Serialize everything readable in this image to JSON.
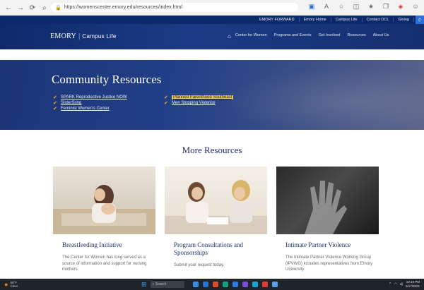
{
  "browser": {
    "url": "https://womenscenter.emory.edu/resources/index.html",
    "nav_icons": [
      "back-icon",
      "forward-icon",
      "refresh-icon"
    ],
    "tool_icons": [
      "extension-icon",
      "read-aloud-icon",
      "favorite-icon",
      "split-screen-icon",
      "favorites-bar-icon",
      "collections-icon",
      "shield-icon",
      "profile-icon"
    ]
  },
  "utility_nav": [
    "Emory Home",
    "Campus Life",
    "Contact OCL",
    "Giving"
  ],
  "utility_first": "EMORY FORWARD",
  "brand": {
    "name": "EMORY",
    "sub": "Campus Life"
  },
  "main_nav": [
    "Center for Women",
    "Programs and Events",
    "Get Involved",
    "Resources",
    "About Us"
  ],
  "community": {
    "title": "Community Resources",
    "col1": [
      "SPARK Reproductive Justice NOW",
      "SisterSong",
      "Feminist Women's Center"
    ],
    "col2": [
      "Planned Parenthood Southeast",
      "Men Stopping Violence"
    ]
  },
  "more_title": "More Resources",
  "cards": [
    {
      "title": "Breastfeeding Initiative",
      "text": "The Center for Women has long served as a source of information and support for nursing mothers"
    },
    {
      "title": "Program Consultations and Sponsorships",
      "text": "Submit your request today."
    },
    {
      "title": "Intimate Partner Violence",
      "text": "The Intimate Partner Violence Working Group (IPVWG) includes representatives from Emory University"
    }
  ],
  "taskbar": {
    "temp": "69°F",
    "weather": "Clear",
    "search": "Search",
    "time": "10:19 PM",
    "date": "5/17/2021"
  },
  "colors": {
    "navy": "#0b2a6b",
    "accent": "#f0b429",
    "link_blue": "#1d3270"
  }
}
